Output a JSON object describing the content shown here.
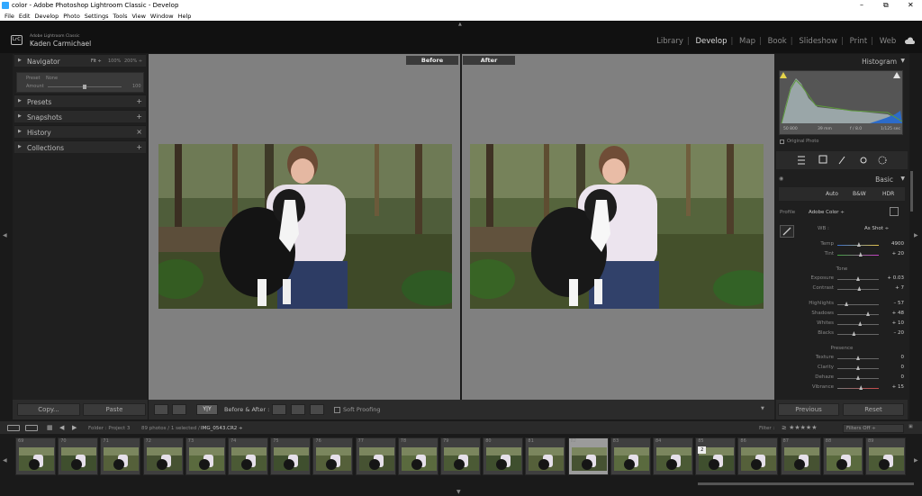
{
  "window": {
    "title": "color - Adobe Photoshop Lightroom Classic - Develop",
    "controls": [
      "–",
      "⧉",
      "✕"
    ]
  },
  "menu": [
    "File",
    "Edit",
    "Develop",
    "Photo",
    "Settings",
    "Tools",
    "View",
    "Window",
    "Help"
  ],
  "identity": {
    "logo": "LrC",
    "app": "Adobe Lightroom Classic",
    "user": "Kaden Carmichael"
  },
  "modules": [
    {
      "label": "Library",
      "active": false
    },
    {
      "label": "Develop",
      "active": true
    },
    {
      "label": "Map",
      "active": false
    },
    {
      "label": "Book",
      "active": false
    },
    {
      "label": "Slideshow",
      "active": false
    },
    {
      "label": "Print",
      "active": false
    },
    {
      "label": "Web",
      "active": false
    }
  ],
  "left": {
    "navigator": {
      "label": "Navigator",
      "zoom": [
        "Fit ÷",
        "100%",
        "200% ÷"
      ]
    },
    "preset_box": {
      "preset_label": "Preset",
      "preset_value": "None",
      "amount_label": "Amount",
      "amount_value": "100"
    },
    "panels": [
      {
        "label": "Presets",
        "action": "+"
      },
      {
        "label": "Snapshots",
        "action": "+"
      },
      {
        "label": "History",
        "action": "×"
      },
      {
        "label": "Collections",
        "action": "+"
      }
    ],
    "copy": "Copy...",
    "paste": "Paste"
  },
  "view": {
    "before": "Before",
    "after": "After"
  },
  "toolbar": {
    "yy": "Y|Y",
    "ba_label": "Before & After :",
    "soft_proof": "Soft Proofing"
  },
  "right": {
    "histogram": "Histogram",
    "hist_info": [
      "50 800",
      "39 mm",
      "f / 8.0",
      "1/125 sec"
    ],
    "original_photo": "Original Photo",
    "basic": "Basic",
    "treatment": [
      "Auto",
      "B&W",
      "HDR"
    ],
    "profile_label": "Profile",
    "profile_value": "Adobe Color ÷",
    "wb_label": "WB :",
    "wb_value": "As Shot ÷",
    "wb_sliders": [
      {
        "name": "Temp",
        "value": "4900",
        "pos": 0.52
      },
      {
        "name": "Tint",
        "value": "+ 20",
        "pos": 0.56
      }
    ],
    "tone_title": "Tone",
    "tone1": [
      {
        "name": "Exposure",
        "value": "+ 0.03",
        "pos": 0.5
      },
      {
        "name": "Contrast",
        "value": "+ 7",
        "pos": 0.53
      }
    ],
    "tone2": [
      {
        "name": "Highlights",
        "value": "– 57",
        "pos": 0.22
      },
      {
        "name": "Shadows",
        "value": "+ 48",
        "pos": 0.74
      },
      {
        "name": "Whites",
        "value": "+ 10",
        "pos": 0.55
      },
      {
        "name": "Blacks",
        "value": "– 20",
        "pos": 0.4
      }
    ],
    "presence_title": "Presence",
    "presence": [
      {
        "name": "Texture",
        "value": "0",
        "pos": 0.5
      },
      {
        "name": "Clarity",
        "value": "0",
        "pos": 0.5
      },
      {
        "name": "Dehaze",
        "value": "0",
        "pos": 0.5
      },
      {
        "name": "Vibrance",
        "value": "+ 15",
        "pos": 0.57
      }
    ],
    "previous": "Previous",
    "reset": "Reset"
  },
  "filmstrip": {
    "source": "Folder : Project 3",
    "count": "89 photos / 1 selected /",
    "file": "IMG_0543.CR2 ÷",
    "filter_label": "Filter :",
    "filters": "Filters Off ÷",
    "numbers": [
      "69",
      "70",
      "71",
      "72",
      "73",
      "74",
      "75",
      "76",
      "77",
      "78",
      "79",
      "80",
      "81",
      "82",
      "83",
      "84",
      "85",
      "86",
      "87",
      "88",
      "89"
    ],
    "selected_index": 13,
    "badge": "2"
  }
}
